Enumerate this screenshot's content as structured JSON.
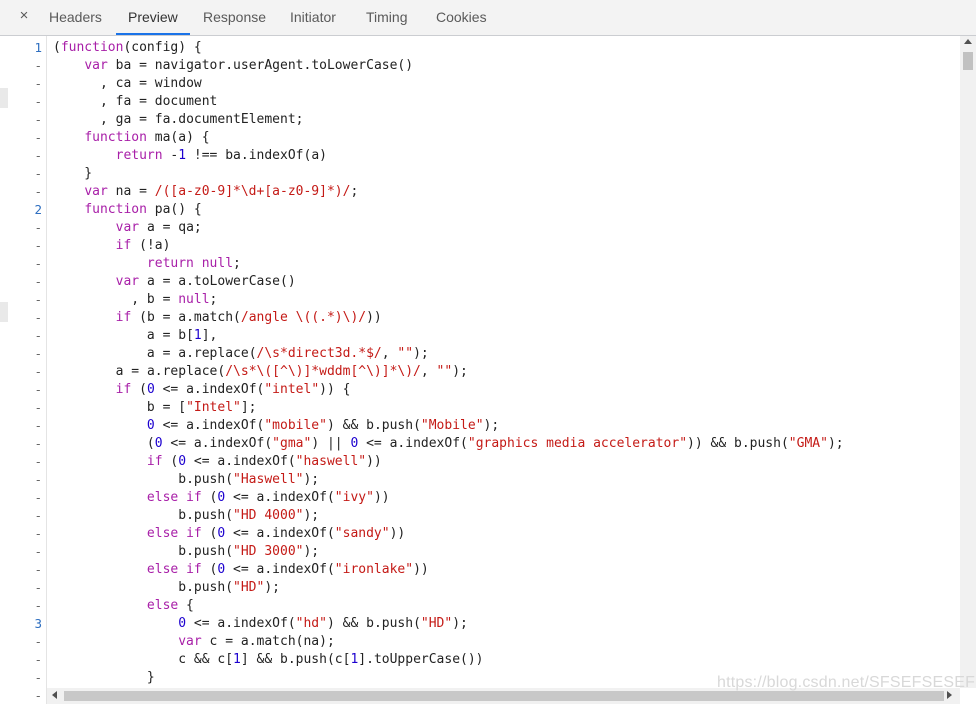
{
  "tabs": {
    "close_icon": "×",
    "items": [
      {
        "label": "Headers"
      },
      {
        "label": "Preview"
      },
      {
        "label": "Response"
      },
      {
        "label": "Initiator"
      },
      {
        "label": "Timing"
      },
      {
        "label": "Cookies"
      }
    ],
    "active": "Preview",
    "accent": "#1a73e8"
  },
  "code": {
    "gutter": [
      "1",
      "-",
      "-",
      "-",
      "-",
      "-",
      "-",
      "-",
      "-",
      "2",
      "-",
      "-",
      "-",
      "-",
      "-",
      "-",
      "-",
      "-",
      "-",
      "-",
      "-",
      "-",
      "-",
      "-",
      "-",
      "-",
      "-",
      "-",
      "-",
      "-",
      "-",
      "-",
      "3",
      "-",
      "-",
      "-",
      "-"
    ],
    "lines": [
      "(function(config) {",
      "    var ba = navigator.userAgent.toLowerCase()",
      "      , ca = window",
      "      , fa = document",
      "      , ga = fa.documentElement;",
      "    function ma(a) {",
      "        return -1 !== ba.indexOf(a)",
      "    }",
      "    var na = /([a-z0-9]*\\d+[a-z0-9]*)/;",
      "    function pa() {",
      "        var a = qa;",
      "        if (!a)",
      "            return null;",
      "        var a = a.toLowerCase()",
      "          , b = null;",
      "        if (b = a.match(/angle \\((.*)\\)/))",
      "            a = b[1],",
      "            a = a.replace(/\\s*direct3d.*$/, \"\");",
      "        a = a.replace(/\\s*\\([^\\)]*wddm[^\\)]*\\)/, \"\");",
      "        if (0 <= a.indexOf(\"intel\")) {",
      "            b = [\"Intel\"];",
      "            0 <= a.indexOf(\"mobile\") && b.push(\"Mobile\");",
      "            (0 <= a.indexOf(\"gma\") || 0 <= a.indexOf(\"graphics media accelerator\")) && b.push(\"GMA\");",
      "            if (0 <= a.indexOf(\"haswell\"))",
      "                b.push(\"Haswell\");",
      "            else if (0 <= a.indexOf(\"ivy\"))",
      "                b.push(\"HD 4000\");",
      "            else if (0 <= a.indexOf(\"sandy\"))",
      "                b.push(\"HD 3000\");",
      "            else if (0 <= a.indexOf(\"ironlake\"))",
      "                b.push(\"HD\");",
      "            else {",
      "                0 <= a.indexOf(\"hd\") && b.push(\"HD\");",
      "                var c = a.match(na);",
      "                c && c[1] && b.push(c[1].toUpperCase())",
      "            }",
      ""
    ]
  },
  "watermark": "https://blog.csdn.net/SFSEFSESEF"
}
